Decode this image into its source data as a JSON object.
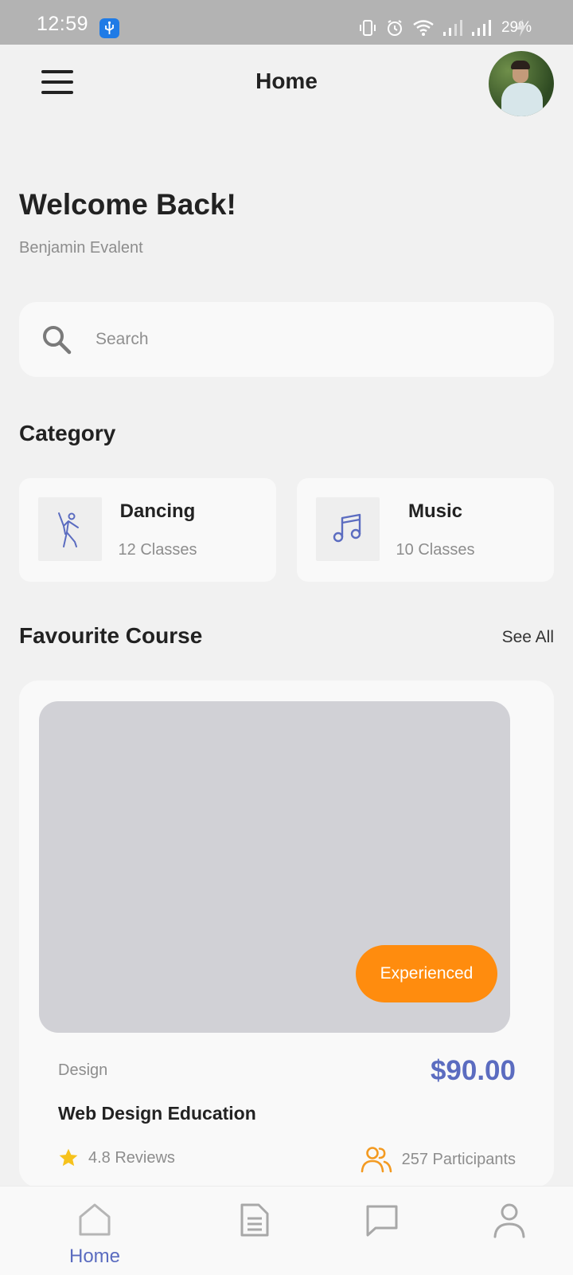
{
  "status_bar": {
    "time": "12:59",
    "battery": "29%",
    "icons": [
      "usb-icon",
      "vibrate-icon",
      "alarm-icon",
      "wifi-icon",
      "signal-icon",
      "signal-icon",
      "charging-icon"
    ]
  },
  "header": {
    "title": "Home",
    "menu_icon": "hamburger-menu-icon",
    "avatar": "profile-avatar"
  },
  "welcome": {
    "title": "Welcome Back!",
    "name": "Benjamin Evalent"
  },
  "search": {
    "placeholder": "Search",
    "value": "",
    "icon": "search-icon"
  },
  "category": {
    "title": "Category",
    "items": [
      {
        "name": "Dancing",
        "count": "12 Classes",
        "icon": "dancer-icon"
      },
      {
        "name": "Music",
        "count": "10 Classes",
        "icon": "music-note-icon"
      }
    ]
  },
  "favourites": {
    "title": "Favourite Course",
    "see_all": "See All",
    "course": {
      "badge": "Experienced",
      "category": "Design",
      "price": "$90.00",
      "title": "Web Design Education",
      "reviews": "4.8 Reviews",
      "participants": "257 Participants"
    }
  },
  "bottom_nav": {
    "items": [
      {
        "label": "Home",
        "icon": "home-icon",
        "active": true
      },
      {
        "label": "",
        "icon": "document-icon",
        "active": false
      },
      {
        "label": "",
        "icon": "chat-icon",
        "active": false
      },
      {
        "label": "",
        "icon": "profile-icon",
        "active": false
      }
    ]
  },
  "colors": {
    "accent": "#5b6cc0",
    "badge": "#ff8c0e",
    "star": "#f6c21c",
    "participants_icon": "#f39a21",
    "status_bar": "#b3b3b3",
    "background": "#f1f1f1",
    "card": "#f9f9f9"
  }
}
